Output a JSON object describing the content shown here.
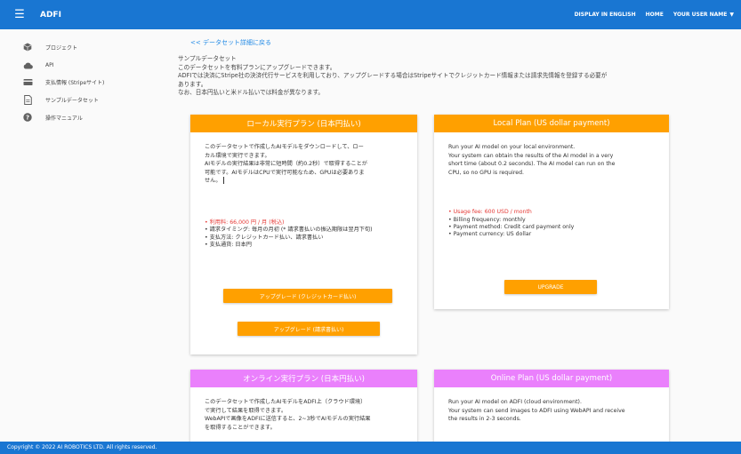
{
  "appbar": {
    "menu_icon": "hamburger-menu-icon",
    "title": "ADFI",
    "display_english": "DISPLAY IN ENGLISH",
    "home": "HOME",
    "user_name": "YOUR USER NAME"
  },
  "sidebar": {
    "items": [
      {
        "label": "プロジェクト",
        "icon": "cube-icon"
      },
      {
        "label": "API",
        "icon": "cloud-icon"
      },
      {
        "label": "支払情報 (Stripeサイト)",
        "icon": "credit-card-icon"
      },
      {
        "label": "サンプルデータセット",
        "icon": "document-icon"
      },
      {
        "label": "操作マニュアル",
        "icon": "help-icon"
      }
    ]
  },
  "main": {
    "back_link": "<< データセット詳細に戻る",
    "description": [
      "サンプルデータセット",
      "このデータセットを有料プランにアップグレードできます。",
      "ADFIでは決済にStripe社の決済代行サービスを利用しており、アップグレードする場合はStripeサイトでクレジットカード情報または請求先情報を登録する必要が",
      "あります。",
      "なお、日本円払いと米ドル払いでは料金が異なります。"
    ]
  },
  "cards": {
    "local_jp": {
      "header": "ローカル実行プラン (日本円払い)",
      "color": "#ffa000",
      "body": [
        "このデータセットで作成したAIモデルをダウンロードして、ロー",
        "カル環境で実行できます。",
        "AIモデルの実行結果は非常に短時間（約0.2秒）で取得することが",
        "可能です。AIモデルはCPUで実行可能なため、GPUは必要ありま",
        "せん。"
      ],
      "bullets": [
        "利用料: 66,000 円 / 月 (税込)",
        "請求タイミング: 毎月の月初 (* 請求書払いの振込期限は翌月下旬)",
        "支払方法: クレジットカード払い、請求書払い",
        "支払通貨: 日本円"
      ],
      "button_card": "アップグレード (クレジットカード払い)",
      "button_invoice": "アップグレード (請求書払い)"
    },
    "local_us": {
      "header": "Local Plan (US dollar payment)",
      "color": "#ffa000",
      "body": [
        "Run your AI model on your local environment.",
        "Your system can obtain the results of the AI model in a very",
        "short time (about 0.2 seconds). The AI model can run on the",
        "CPU, so no GPU is required."
      ],
      "bullets": [
        "Usage fee: 600 USD / month",
        "Billing frequency: monthly",
        "Payment method: Credit card payment only",
        "Payment currency: US dollar"
      ],
      "button": "UPGRADE"
    },
    "online_jp": {
      "header": "オンライン実行プラン (日本円払い)",
      "color": "#ea80fc",
      "body": [
        "このデータセットで作成したAIモデルをADFI上（クラウド環境）",
        "で実行して結果を取得できます。",
        "WebAPIで画像をADFIに送信すると、2~3秒でAIモデルの実行結果",
        "を取得することができます。"
      ]
    },
    "online_us": {
      "header": "Online Plan (US dollar payment)",
      "color": "#ea80fc",
      "body": [
        "Run your AI model on ADFI (cloud environment).",
        "Your system can send images to ADFI using WebAPI and receive",
        "the results in 2-3 seconds."
      ]
    }
  },
  "footer": {
    "copyright": "Copyright © 2022 AI ROBOTICS LTD. All rights reserved."
  }
}
